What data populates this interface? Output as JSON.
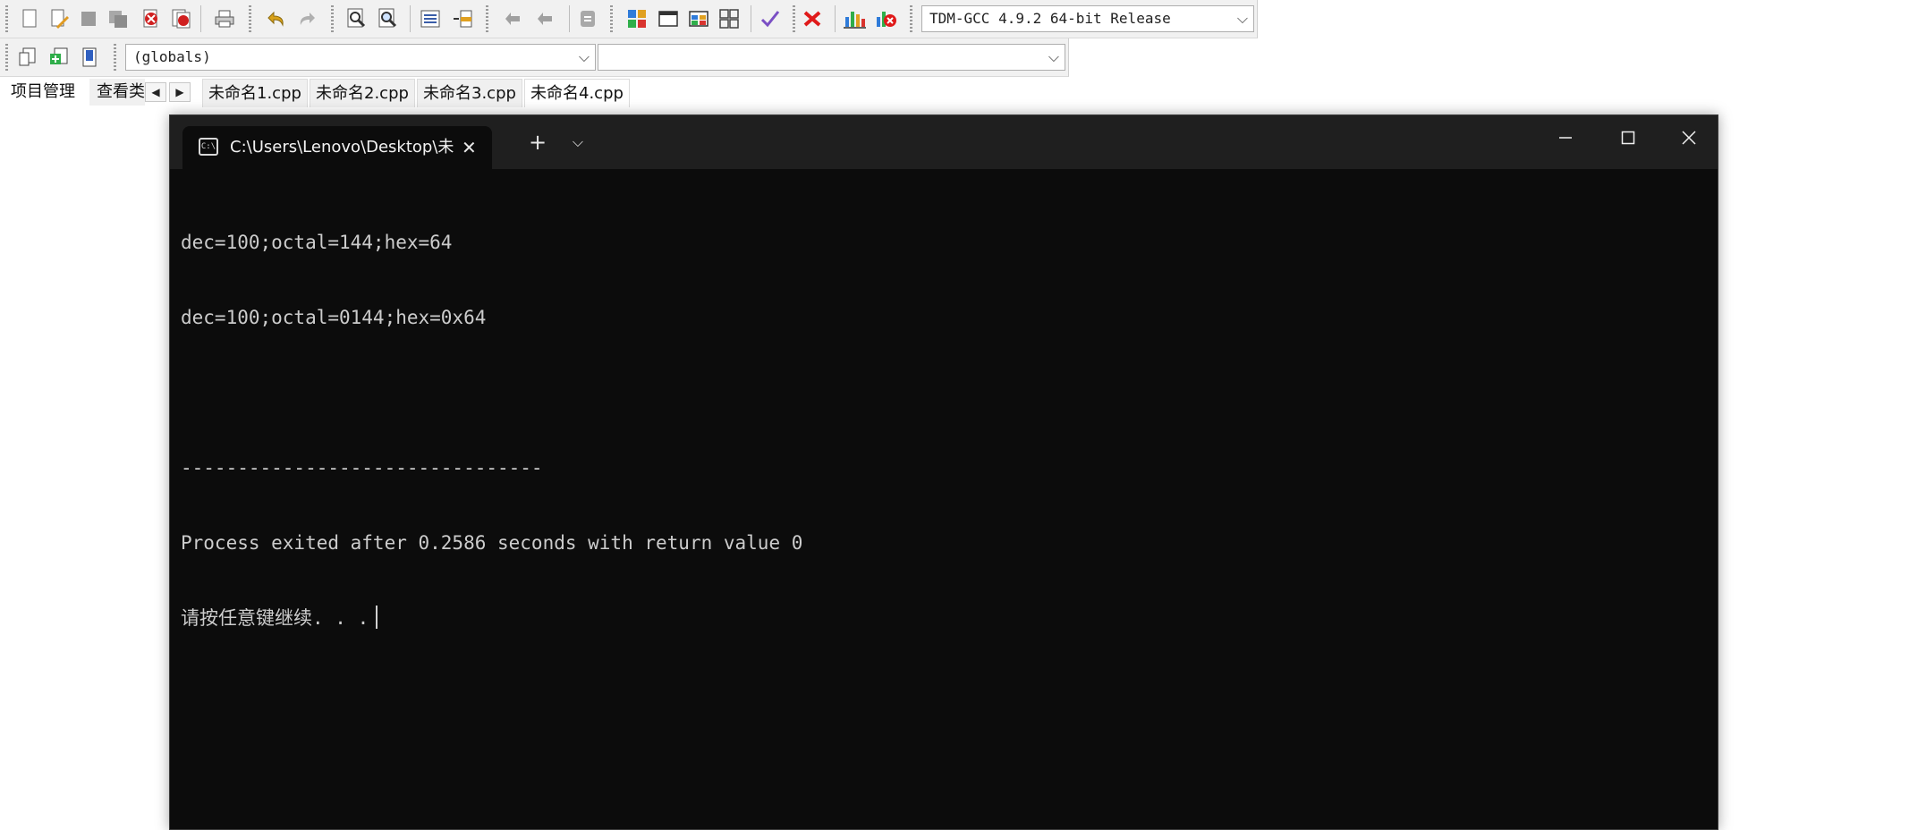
{
  "toolbar": {
    "compiler_value": "TDM-GCC 4.9.2 64-bit Release",
    "scope_value": "(globals)",
    "member_value": "",
    "icons": [
      "new-file-icon",
      "open-file-icon",
      "save-icon",
      "save-all-icon",
      "close-icon",
      "close-all-icon",
      "print-icon",
      "undo-icon",
      "redo-icon",
      "find-icon",
      "replace-icon",
      "indent-icon",
      "unindent-icon",
      "bookmark-prev-icon",
      "bookmark-next-icon",
      "goto-icon",
      "compile-icon",
      "run-icon",
      "compile-run-icon",
      "rebuild-icon",
      "syntax-check-icon",
      "stop-icon",
      "chart-icon",
      "debug-icon",
      "class-icon",
      "add-icon",
      "bookmark-icon"
    ]
  },
  "tabs": {
    "project_tab": "项目管理",
    "classes_tab": "查看类",
    "files": [
      "未命名1.cpp",
      "未命名2.cpp",
      "未命名3.cpp",
      "未命名4.cpp"
    ],
    "active_index": 3
  },
  "terminal": {
    "tab_title": "C:\\Users\\Lenovo\\Desktop\\未命",
    "lines": [
      "dec=100;octal=144;hex=64",
      "dec=100;octal=0144;hex=0x64",
      "",
      "--------------------------------",
      "Process exited after 0.2586 seconds with return value 0",
      "请按任意键继续. . ."
    ]
  },
  "colors": {
    "terminal_bg": "#0c0c0c",
    "terminal_text": "#cccccc",
    "toolbar_bg": "#f1f1f1"
  }
}
